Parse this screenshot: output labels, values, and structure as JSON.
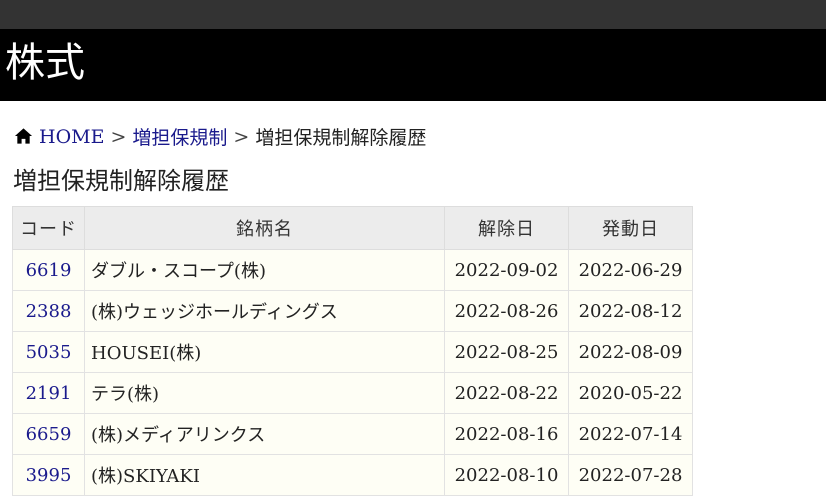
{
  "site": {
    "title": "株式"
  },
  "breadcrumb": {
    "home_icon": "home-icon",
    "home": "HOME",
    "separator": ">",
    "parent": "増担保規制",
    "current": "増担保規制解除履歴"
  },
  "page": {
    "title": "増担保規制解除履歴"
  },
  "table": {
    "headers": {
      "code": "コード",
      "name": "銘柄名",
      "release_date": "解除日",
      "trigger_date": "発動日"
    },
    "rows": [
      {
        "code": "6619",
        "name": "ダブル・スコープ(株)",
        "release_date": "2022-09-02",
        "trigger_date": "2022-06-29"
      },
      {
        "code": "2388",
        "name": "(株)ウェッジホールディングス",
        "release_date": "2022-08-26",
        "trigger_date": "2022-08-12"
      },
      {
        "code": "5035",
        "name": "HOUSEI(株)",
        "release_date": "2022-08-25",
        "trigger_date": "2022-08-09"
      },
      {
        "code": "2191",
        "name": "テラ(株)",
        "release_date": "2022-08-22",
        "trigger_date": "2020-05-22"
      },
      {
        "code": "6659",
        "name": "(株)メディアリンクス",
        "release_date": "2022-08-16",
        "trigger_date": "2022-07-14"
      },
      {
        "code": "3995",
        "name": "(株)SKIYAKI",
        "release_date": "2022-08-10",
        "trigger_date": "2022-07-28"
      }
    ]
  },
  "colors": {
    "header_bg": "#000000",
    "topbar_bg": "#333333",
    "link": "#1a1a8c",
    "row_bg": "#fefef5",
    "table_header_bg": "#ececec"
  }
}
